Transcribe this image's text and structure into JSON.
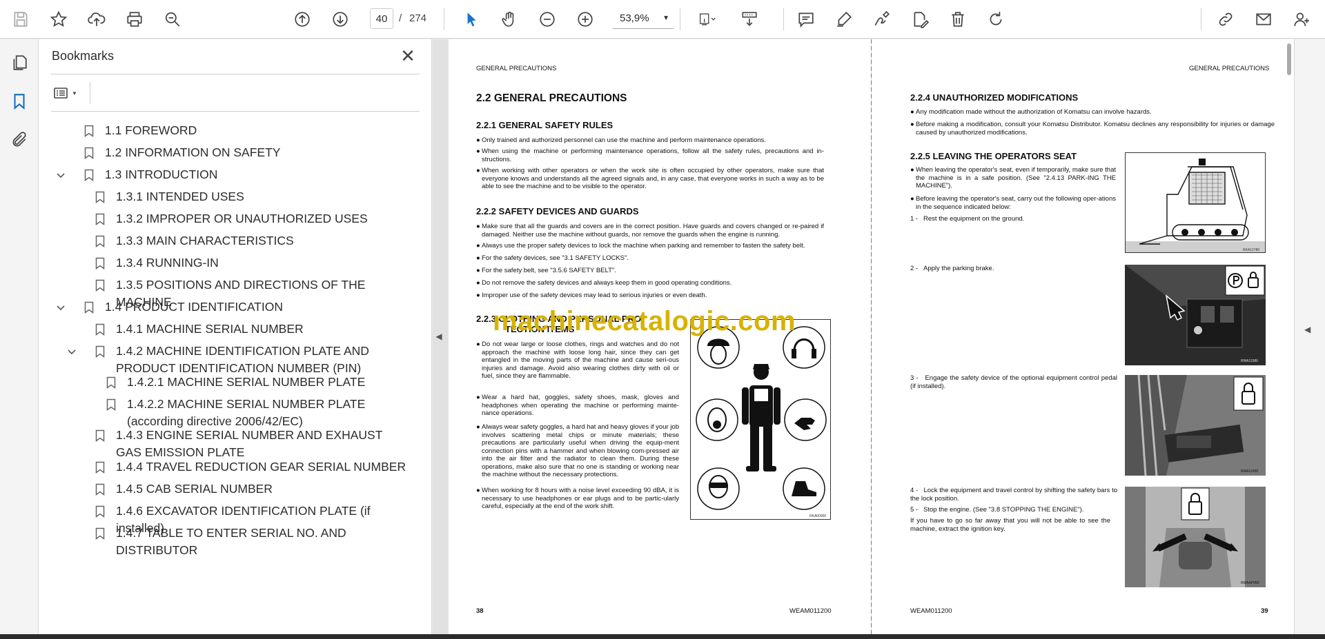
{
  "toolbar": {
    "page_current": "40",
    "page_separator": "/",
    "page_total": "274",
    "zoom_value": "53,9%"
  },
  "panel": {
    "title": "Bookmarks",
    "close_glyph": "✕"
  },
  "bookmarks": [
    {
      "label": "1.1 FOREWORD",
      "level": 0,
      "expanded": null
    },
    {
      "label": "1.2 INFORMATION ON SAFETY",
      "level": 0,
      "expanded": null
    },
    {
      "label": "1.3 INTRODUCTION",
      "level": 0,
      "expanded": true
    },
    {
      "label": "1.3.1 INTENDED USES",
      "level": 1,
      "expanded": null
    },
    {
      "label": "1.3.2 IMPROPER OR UNAUTHORIZED USES",
      "level": 1,
      "expanded": null
    },
    {
      "label": "1.3.3 MAIN CHARACTERISTICS",
      "level": 1,
      "expanded": null
    },
    {
      "label": "1.3.4 RUNNING-IN",
      "level": 1,
      "expanded": null
    },
    {
      "label": "1.3.5 POSITIONS AND DIRECTIONS OF THE MACHINE",
      "level": 1,
      "expanded": null
    },
    {
      "label": "1.4 PRODUCT IDENTIFICATION",
      "level": 0,
      "expanded": true
    },
    {
      "label": "1.4.1 MACHINE SERIAL NUMBER",
      "level": 1,
      "expanded": null
    },
    {
      "label": "1.4.2 MACHINE IDENTIFICATION PLATE AND PRODUCT IDENTIFICATION NUMBER (PIN)",
      "level": 1,
      "expanded": true
    },
    {
      "label": "1.4.2.1 MACHINE SERIAL NUMBER PLATE",
      "level": 2,
      "expanded": null
    },
    {
      "label": "1.4.2.2 MACHINE SERIAL NUMBER PLATE (according directive 2006/42/EC)",
      "level": 2,
      "expanded": null
    },
    {
      "label": "1.4.3 ENGINE SERIAL NUMBER AND EXHAUST GAS EMISSION PLATE",
      "level": 1,
      "expanded": null
    },
    {
      "label": "1.4.4 TRAVEL REDUCTION GEAR SERIAL NUMBER",
      "level": 1,
      "expanded": null
    },
    {
      "label": "1.4.5 CAB SERIAL NUMBER",
      "level": 1,
      "expanded": null
    },
    {
      "label": "1.4.6 EXCAVATOR IDENTIFICATION PLATE (if installed)",
      "level": 1,
      "expanded": null
    },
    {
      "label": "1.4.7 TABLE TO ENTER SERIAL NO. AND DISTRIBUTOR",
      "level": 1,
      "expanded": null
    }
  ],
  "page_left": {
    "header": "GENERAL PRECAUTIONS",
    "h_22": "2.2   GENERAL PRECAUTIONS",
    "h_221": "2.2.1   GENERAL SAFETY RULES",
    "rules_221": [
      "Only trained and authorized personnel can use the machine and perform maintenance operations.",
      "When using the machine or performing maintenance operations, follow all the safety rules, precautions and in-structions.",
      "When working with other operators or when the work site is often occupied by other operators, make sure that everyone knows and understands all the agreed signals and, in any case, that everyone works in such a way as to be able to see the machine and to be visible to the operator."
    ],
    "h_222": "2.2.2   SAFETY DEVICES AND GUARDS",
    "rules_222": [
      "Make sure that all the guards and covers are in the correct position. Have guards and covers changed or re-paired if damaged. Neither use the machine without guards, nor remove the guards when the engine is running.",
      "Always use the proper safety devices to lock the machine when parking and remember to fasten the safety belt.",
      "For the safety devices, see \"3.1 SAFETY LOCKS\".",
      "For the safety belt, see \"3.5.6 SAFETY BELT\".",
      "Do not remove the safety devices and always keep them in good operating conditions.",
      "Improper use of the safety devices may lead to serious injuries or even death."
    ],
    "h_223_line1": "2.2.3   CLOTHING AND PERSONAL PRO-",
    "h_223_line2": "TECTION ITEMS",
    "rules_223": [
      "Do not wear large or loose clothes, rings and watches and do not approach the machine with loose long hair, since they can get entangled in the moving parts of the machine and cause seri-ous injuries and damage. Avoid also wearing clothes dirty with oil or fuel, since they are flammable.",
      "Wear a hard hat, goggles, safety shoes, mask, gloves and headphones when operating the machine or performing mainte-nance operations.",
      "Always wear safety goggles, a hard hat and heavy gloves if your job involves scattering metal chips or minute materials; these precautions are particularly useful when driving the equip-ment connection pins with a hammer and when blowing com-pressed air into the air filter and the radiator to clean them. During these operations, make also sure that no one is standing or working near the machine without the necessary protections.",
      "When working for 8 hours with a noise level exceeding 90 dBA, it is necessary to use headphones or ear plugs and to be partic-ularly careful, especially at the end of the work shift."
    ],
    "figure_caption": "RKA00900",
    "page_number": "38",
    "doc_code": "WEAM011200"
  },
  "page_right": {
    "header": "GENERAL PRECAUTIONS",
    "h_224": "2.2.4   UNAUTHORIZED MODIFICATIONS",
    "rules_224": [
      "Any modification made without the authorization of Komatsu can involve hazards.",
      "Before making a modification, consult your Komatsu Distributor. Komatsu declines any responsibility for injuries or damage caused by unauthorized modifications."
    ],
    "h_225": "2.2.5   LEAVING THE OPERATORS SEAT",
    "rules_225": [
      "When leaving the operator's seat, even if temporarily, make sure that the machine is in a safe position. (See \"2.4.13 PARK-ING THE MACHINE\").",
      "Before leaving the operator's seat, carry out the following oper-ations in the sequence indicated below:"
    ],
    "steps": [
      {
        "num": "1 -",
        "text": "Rest the equipment on the ground."
      },
      {
        "num": "2 -",
        "text": "Apply the parking brake."
      },
      {
        "num": "3 -",
        "text": "Engage the safety device of the optional equipment control pedal (if installed)."
      },
      {
        "num": "4 -",
        "text": "Lock the equipment and travel control by shifting the safety bars to the lock position."
      },
      {
        "num": "5 -",
        "text": "Stop the engine. (See \"3.8 STOPPING THE ENGINE\")."
      }
    ],
    "note": "If you have to go so far away that you will not be able to see the machine, extract the ignition key.",
    "captions": [
      "RKA12780",
      "RWA11580",
      "RWA12430",
      "RWAAP950"
    ],
    "page_number": "39",
    "doc_code": "WEAM011200"
  },
  "watermark": "machinecatalogic.com",
  "icons": [
    "save-icon",
    "star-icon",
    "upload-icon",
    "print-icon",
    "zoom-search-icon",
    "page-up-icon",
    "page-down-icon",
    "select-cursor-icon",
    "hand-icon",
    "zoom-out-icon",
    "zoom-in-icon",
    "fit-page-icon",
    "scroll-mode-icon",
    "comment-icon",
    "highlight-icon",
    "sign-icon",
    "edit-pdf-icon",
    "delete-icon",
    "rotate-icon",
    "share-link-icon",
    "email-icon",
    "account-icon"
  ]
}
